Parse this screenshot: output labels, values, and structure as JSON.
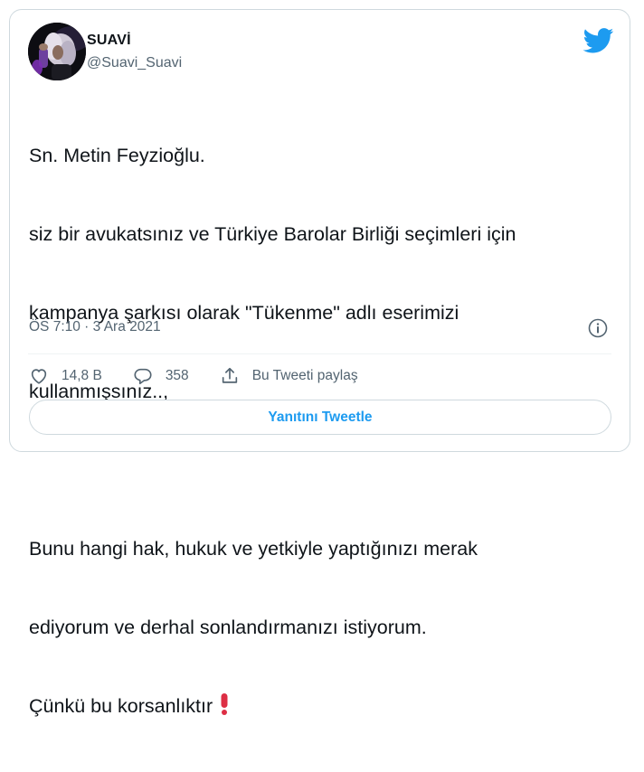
{
  "author": {
    "display_name": "SUAVİ",
    "handle": "@Suavi_Suavi"
  },
  "tweet": {
    "lines": [
      "Sn. Metin Feyzioğlu.",
      "siz bir avukatsınız ve Türkiye Barolar Birliği seçimleri için",
      "kampanya şarkısı olarak \"Tükenme\" adlı eserimizi",
      "kullanmışsınız..,",
      "",
      "Bunu hangi hak, hukuk ve yetkiyle yaptığınızı merak",
      "ediyorum ve derhal sonlandırmanızı istiyorum.",
      "Çünkü bu korsanlıktır"
    ],
    "emoji": "red-exclamation-icon",
    "timestamp": "ÖS 7:10 · 3 Ara 2021"
  },
  "actions": {
    "like_count": "14,8 B",
    "reply_count": "358",
    "share_label": "Bu Tweeti paylaş"
  },
  "reply_button_label": "Yanıtını Tweetle",
  "colors": {
    "accent": "#1d9bf0",
    "text": "#0f1419",
    "secondary": "#536471",
    "border": "#cfd9de",
    "emoji_red": "#dd2e44"
  }
}
